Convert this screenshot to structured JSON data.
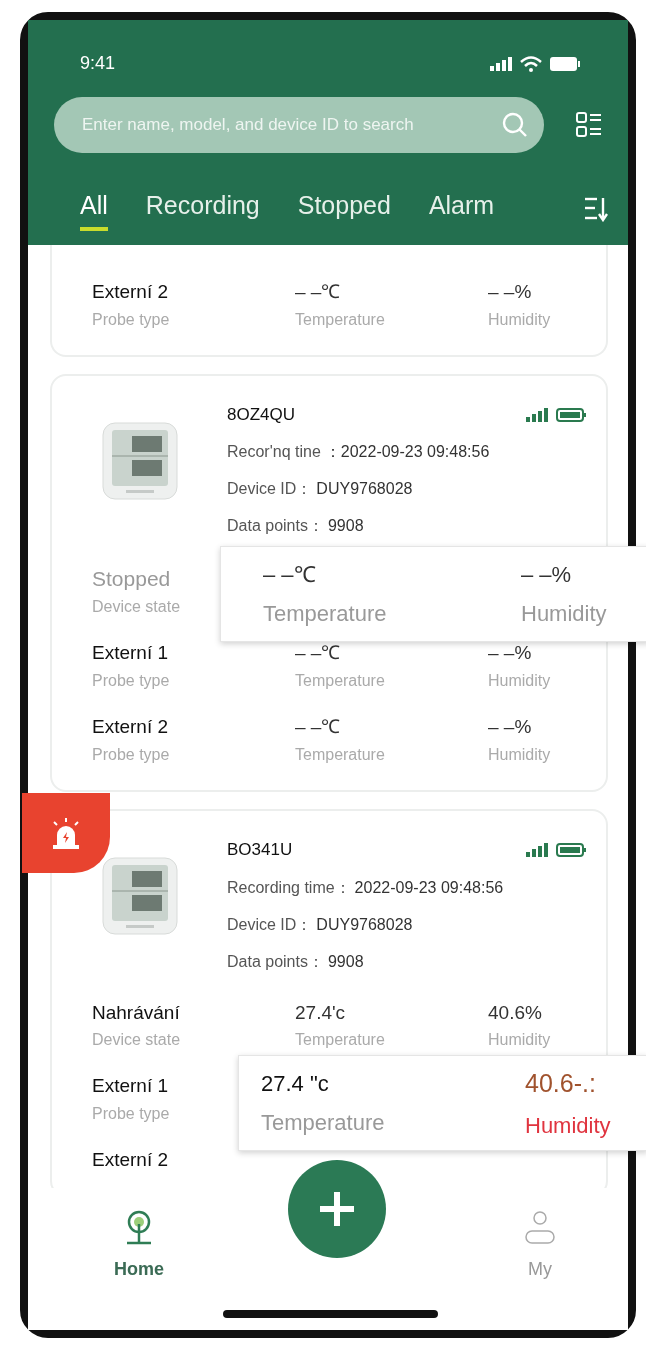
{
  "status_bar": {
    "time": "9:41"
  },
  "search": {
    "placeholder": "Enter name, model, and device ID to search"
  },
  "tabs": [
    {
      "label": "All",
      "selected": true
    },
    {
      "label": "Recording",
      "selected": false
    },
    {
      "label": "Stopped",
      "selected": false
    },
    {
      "label": "Alarm",
      "selected": false
    }
  ],
  "devices": [
    {
      "rows": [
        {
          "label": "Externí 2",
          "caption": "Probe type",
          "temperature": "– –℃",
          "temperature_caption": "Temperature",
          "humidity": "– –%",
          "humidity_caption": "Humidity"
        }
      ]
    },
    {
      "name": "8OZ4QU",
      "alarm": false,
      "fields": [
        {
          "label": "Recor'nq tine",
          "value": "：2022-09-23 09:48:56"
        },
        {
          "label": "Device ID：",
          "value": "DUY9768028"
        },
        {
          "label": "Data points：",
          "value": "9908"
        }
      ],
      "rows": [
        {
          "label": "Stopped",
          "caption": "Device state",
          "dimmed": true,
          "popup": {
            "temperature": "– –℃",
            "temperature_caption": "Temperature",
            "humidity": "– –%",
            "humidity_caption": "Humidity",
            "alert": false
          }
        },
        {
          "label": "Externí 1",
          "caption": "Probe type",
          "temperature": "– –℃",
          "temperature_caption": "Temperature",
          "humidity": "– –%",
          "humidity_caption": "Humidity"
        },
        {
          "label": "Externí 2",
          "caption": "Probe type",
          "temperature": "– –℃",
          "temperature_caption": "Temperature",
          "humidity": "– –%",
          "humidity_caption": "Humidity"
        }
      ]
    },
    {
      "name": "BO341U",
      "alarm": true,
      "fields": [
        {
          "label": "Recording time：",
          "value": "2022-09-23 09:48:56"
        },
        {
          "label": "Device ID：",
          "value": "DUY9768028"
        },
        {
          "label": "Data points：",
          "value": "9908"
        }
      ],
      "rows": [
        {
          "label": "Nahrávání",
          "caption": "Device state",
          "dimmed": false,
          "temperature": "27.4'c",
          "temperature_caption": "Temperature",
          "humidity": "40.6%",
          "humidity_caption": "Humidity"
        },
        {
          "label": "Externí 1",
          "caption": "Probe type",
          "popup": {
            "temperature": "27.4 \"c",
            "temperature_caption": "Temperature",
            "humidity": "40.6-.:",
            "humidity_caption": "Humidity",
            "alert": true
          }
        },
        {
          "label": "Externí 2"
        }
      ]
    }
  ],
  "bottom_nav": [
    {
      "label": "Home",
      "selected": true,
      "kind": "home"
    },
    {
      "label": "My",
      "selected": false,
      "kind": "profile"
    }
  ]
}
